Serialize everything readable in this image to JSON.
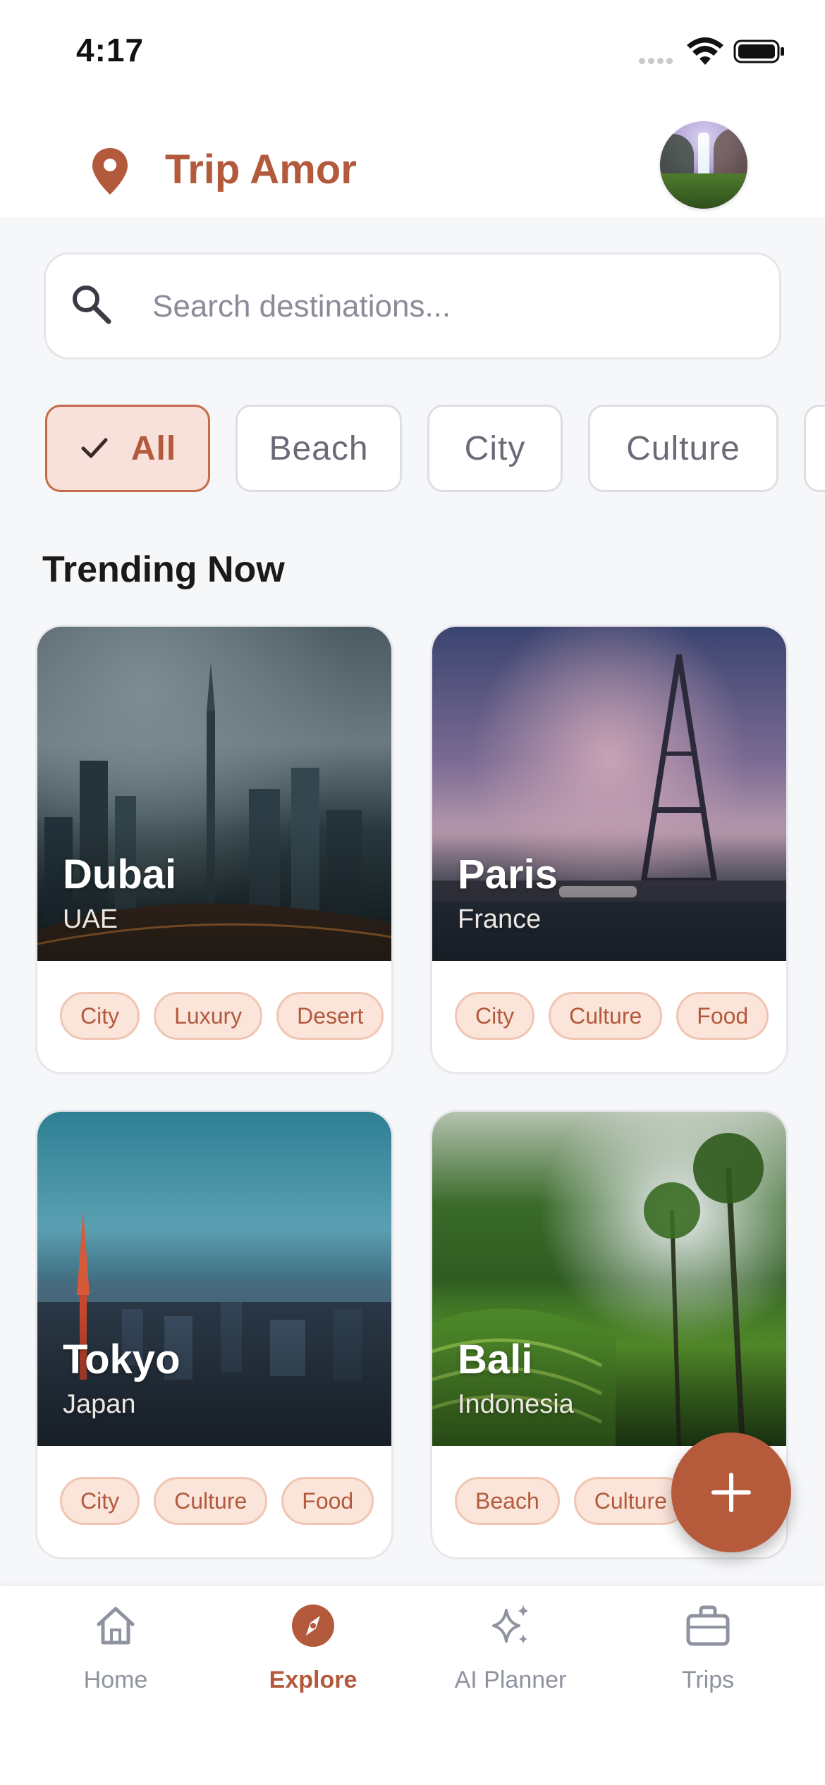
{
  "status_bar": {
    "time": "4:17"
  },
  "header": {
    "app_title": "Trip Amor"
  },
  "search": {
    "placeholder": "Search destinations..."
  },
  "filters": [
    {
      "label": "All",
      "active": true
    },
    {
      "label": "Beach",
      "active": false
    },
    {
      "label": "City",
      "active": false
    },
    {
      "label": "Culture",
      "active": false
    }
  ],
  "section": {
    "title": "Trending Now"
  },
  "destinations": [
    {
      "name": "Dubai",
      "country": "UAE",
      "tags": [
        "City",
        "Luxury",
        "Desert"
      ]
    },
    {
      "name": "Paris",
      "country": "France",
      "tags": [
        "City",
        "Culture",
        "Food"
      ]
    },
    {
      "name": "Tokyo",
      "country": "Japan",
      "tags": [
        "City",
        "Culture",
        "Food"
      ]
    },
    {
      "name": "Bali",
      "country": "Indonesia",
      "tags": [
        "Beach",
        "Culture"
      ]
    }
  ],
  "fab": {
    "icon": "plus-icon"
  },
  "bottom_nav": [
    {
      "label": "Home",
      "icon": "home-icon",
      "active": false
    },
    {
      "label": "Explore",
      "icon": "compass-icon",
      "active": true
    },
    {
      "label": "AI Planner",
      "icon": "sparkles-icon",
      "active": false
    },
    {
      "label": "Trips",
      "icon": "briefcase-icon",
      "active": false
    }
  ],
  "colors": {
    "accent": "#b35a3c",
    "chip_active_bg": "#f8e1da",
    "tag_bg": "#fbe4da",
    "background": "#f6f7f9"
  }
}
